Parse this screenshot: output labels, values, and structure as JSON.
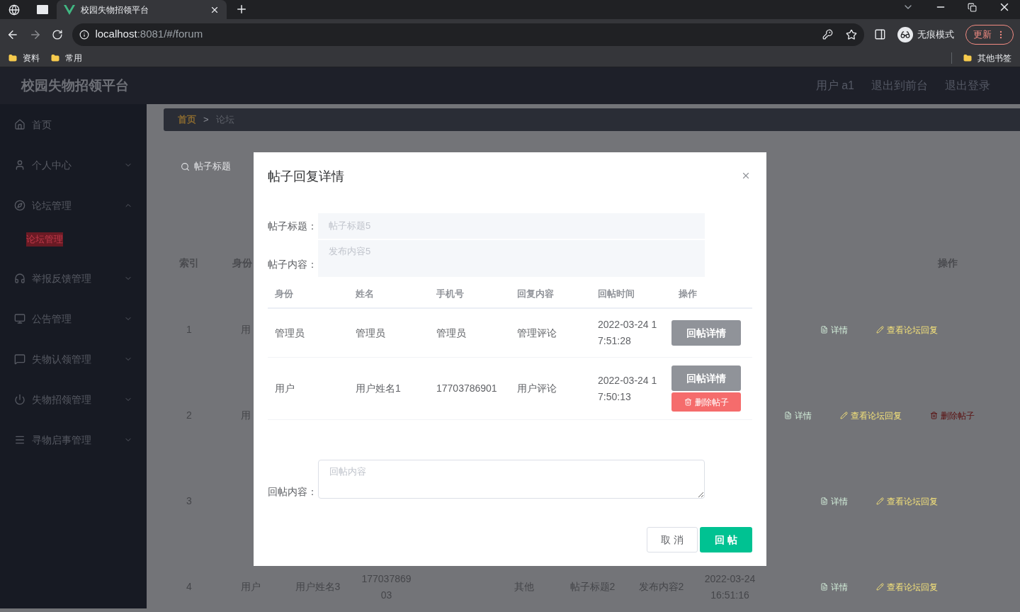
{
  "browser": {
    "tabs": [
      {
        "kind": "globe",
        "selected": false
      },
      {
        "kind": "window",
        "selected": false
      },
      {
        "kind": "site",
        "title": "校园失物招领平台",
        "selected": true
      }
    ],
    "url": {
      "host": "localhost",
      "path": ":8081/#/forum"
    },
    "profile": "无痕模式",
    "update_button": "更新",
    "bookmarks": [
      "资料",
      "常用"
    ],
    "other_bookmarks": "其他书签"
  },
  "app": {
    "title": "校园失物招领平台",
    "header_links": [
      "用户 a1",
      "退出到前台",
      "退出登录"
    ]
  },
  "sidebar": {
    "items": [
      {
        "label": "首页",
        "kind": "link"
      },
      {
        "label": "个人中心",
        "kind": "group",
        "expanded": false
      },
      {
        "label": "论坛管理",
        "kind": "group",
        "expanded": true,
        "children": [
          {
            "label": "论坛管理",
            "selected": true
          }
        ]
      },
      {
        "label": "举报反馈管理",
        "kind": "group",
        "expanded": false
      },
      {
        "label": "公告管理",
        "kind": "group",
        "expanded": false
      },
      {
        "label": "失物认领管理",
        "kind": "group",
        "expanded": false
      },
      {
        "label": "失物招领管理",
        "kind": "group",
        "expanded": false
      },
      {
        "label": "寻物启事管理",
        "kind": "group",
        "expanded": false
      }
    ]
  },
  "breadcrumb": {
    "items": [
      "首页",
      "论坛"
    ],
    "separator": ">"
  },
  "search": {
    "placeholder": "帖子标题"
  },
  "table": {
    "header": {
      "index": "索引",
      "identity": "身份",
      "actions": "操作"
    },
    "rows": [
      {
        "index": "1",
        "identity": "用",
        "actions": [
          {
            "label": "详情",
            "kind": "detail"
          },
          {
            "label": "查看论坛回复",
            "kind": "replies"
          }
        ]
      },
      {
        "index": "2",
        "identity": "用",
        "actions": [
          {
            "label": "详情",
            "kind": "detail"
          },
          {
            "label": "查看论坛回复",
            "kind": "replies"
          },
          {
            "label": "删除帖子",
            "kind": "delete"
          }
        ]
      },
      {
        "index": "3",
        "actions": [
          {
            "label": "详情",
            "kind": "detail"
          },
          {
            "label": "查看论坛回复",
            "kind": "replies"
          }
        ]
      },
      {
        "index": "4",
        "identity": "用户",
        "name": "用户姓名3",
        "phone": "17703786903",
        "type": "其他",
        "title": "帖子标题2",
        "content": "发布内容2",
        "time": "2022-03-24 16:51:16",
        "actions": [
          {
            "label": "详情",
            "kind": "detail"
          },
          {
            "label": "查看论坛回复",
            "kind": "replies"
          }
        ]
      }
    ]
  },
  "dialog": {
    "title": "帖子回复详情",
    "fields": [
      {
        "label": "帖子标题：",
        "value": "帖子标题5",
        "kind": "input",
        "disabled": true
      },
      {
        "label": "帖子内容：",
        "value": "发布内容5",
        "kind": "textarea",
        "disabled": true
      }
    ],
    "replies": {
      "columns": [
        "身份",
        "姓名",
        "手机号",
        "回复内容",
        "回帖时间",
        "操作"
      ],
      "rows": [
        {
          "identity": "管理员",
          "name": "管理员",
          "phone": "管理员",
          "content": "管理评论",
          "time": "2022-03-24 17:51:28",
          "actions": [
            {
              "label": "回帖详情",
              "kind": "detail"
            }
          ]
        },
        {
          "identity": "用户",
          "name": "用户姓名1",
          "phone": "17703786901",
          "content": "用户评论",
          "time": "2022-03-24 17:50:13",
          "actions": [
            {
              "label": "回帖详情",
              "kind": "detail"
            },
            {
              "label": "删除帖子",
              "kind": "delete"
            }
          ]
        }
      ]
    },
    "reply_field": {
      "label": "回帖内容：",
      "placeholder": "回帖内容"
    },
    "buttons": [
      {
        "label": "取 消",
        "kind": "default"
      },
      {
        "label": "回 帖",
        "kind": "primary"
      }
    ]
  }
}
